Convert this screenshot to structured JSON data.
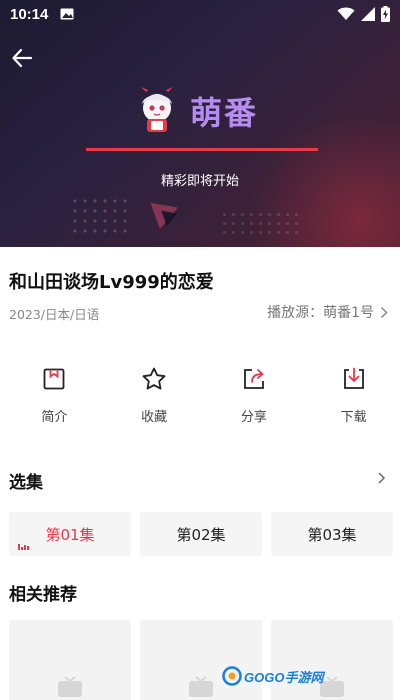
{
  "status_bar": {
    "time": "10:14",
    "icons": [
      "image-icon",
      "wifi-icon",
      "cellular-icon",
      "battery-charging-icon"
    ]
  },
  "player": {
    "brand_name": "萌番",
    "loading_text": "精彩即将开始",
    "loading_progress": 1.0,
    "accent_color": "#e8394a",
    "brand_color": "#b58cf0"
  },
  "info": {
    "title": "和山田谈场Lv999的恋爱",
    "meta": "2023/日本/日语",
    "source_label": "播放源：萌番1号"
  },
  "actions": [
    {
      "label": "简介",
      "icon": "bookmark-icon"
    },
    {
      "label": "收藏",
      "icon": "star-icon"
    },
    {
      "label": "分享",
      "icon": "share-icon"
    },
    {
      "label": "下载",
      "icon": "download-icon"
    }
  ],
  "episodes": {
    "section_title": "选集",
    "items": [
      {
        "label": "第01集",
        "active": true
      },
      {
        "label": "第02集",
        "active": false
      },
      {
        "label": "第03集",
        "active": false
      }
    ]
  },
  "recommendations": {
    "section_title": "相关推荐",
    "items": [
      {},
      {},
      {}
    ]
  },
  "watermark": {
    "text": "GOGO手游网"
  }
}
